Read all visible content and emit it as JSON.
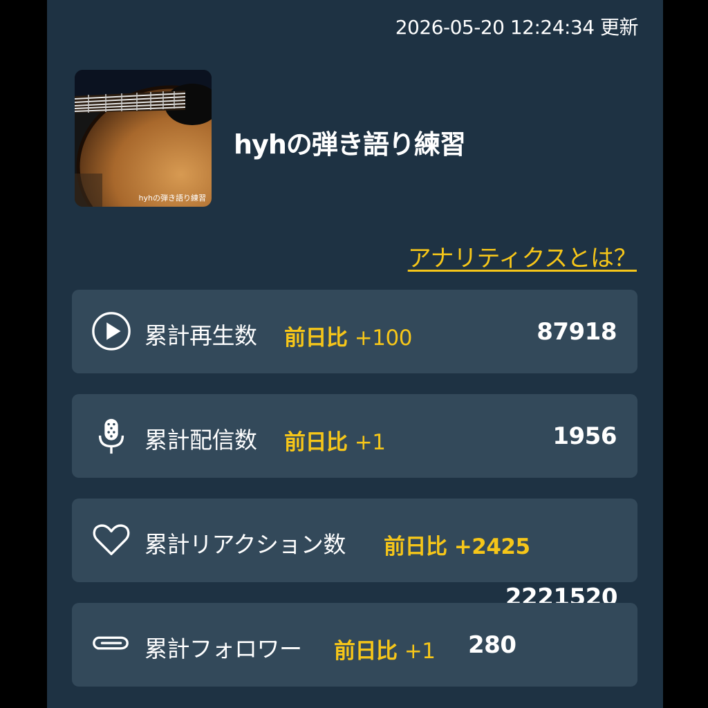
{
  "updated_text": "2026-05-20 12:24:34 更新",
  "channel": {
    "title": "hyhの弾き語り練習",
    "thumbnail_caption": "hyhの弾き語り練習"
  },
  "analytics_link": "アナリティクスとは？",
  "colors": {
    "background": "#1e3243",
    "card": "#33495a",
    "accent": "#f6c619",
    "text": "#ffffff"
  },
  "stats": [
    {
      "icon": "play-circle-icon",
      "label": "累計再生数",
      "change_prefix": "前日比",
      "change": "+100",
      "value": "87918"
    },
    {
      "icon": "microphone-icon",
      "label": "累計配信数",
      "change_prefix": "前日比",
      "change": "+1",
      "value": "1956"
    },
    {
      "icon": "heart-icon",
      "label": "累計リアクション数",
      "change_prefix": "前日比",
      "change": "+2425",
      "value": "2221520"
    },
    {
      "icon": "paperclip-icon",
      "label": "累計フォロワー",
      "change_prefix": "前日比",
      "change": "+1",
      "value": "280"
    }
  ]
}
